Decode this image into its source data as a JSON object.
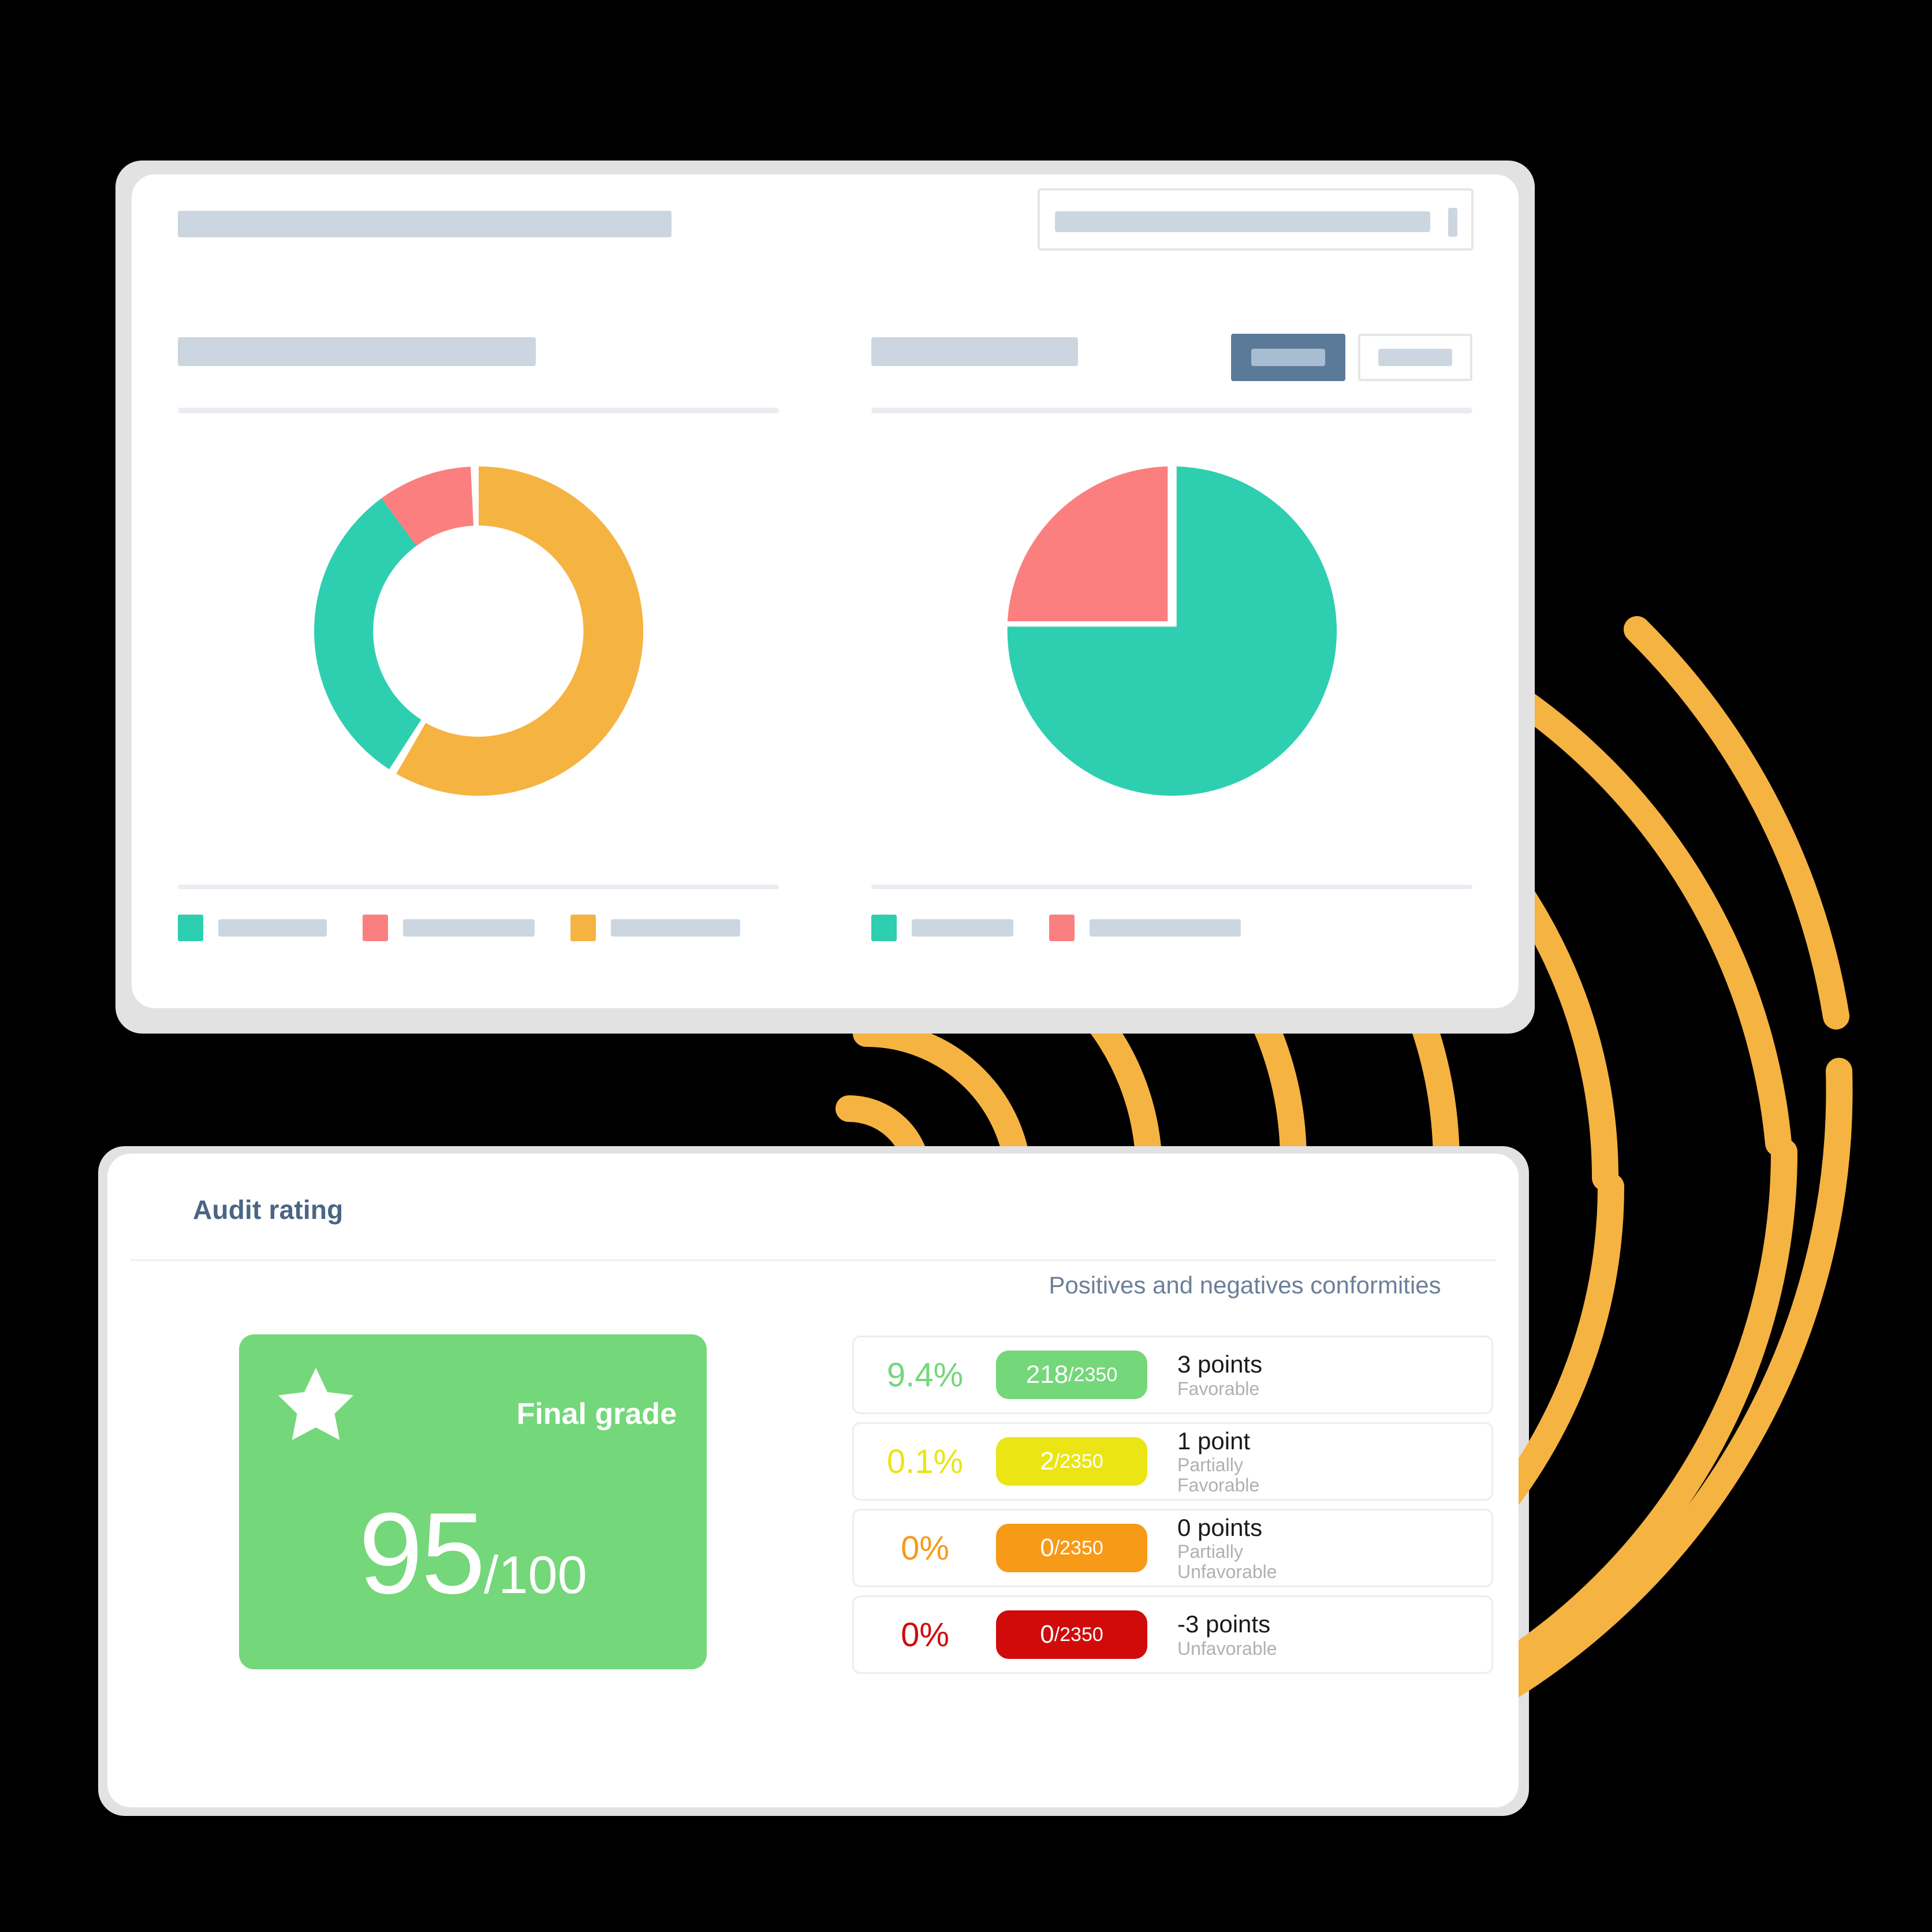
{
  "colors": {
    "teal": "#2ecfb0",
    "salmon": "#fb7f7f",
    "amber": "#f5b342",
    "fingerprint": "#f5b342",
    "slate": "#5b7a99",
    "skeleton": "#ccd6e0",
    "green": "#74d77a",
    "yellow": "#ebe515",
    "orange": "#f79a18",
    "red": "#d10a0a",
    "title_blue": "#4a6585",
    "subtitle_blue": "#6b7f99"
  },
  "dashboard_card": {
    "header": {
      "title_placeholder": "",
      "search": {
        "name": "search-input",
        "value": "",
        "placeholder": ""
      }
    },
    "panels": [
      {
        "name": "donut-panel",
        "heading_placeholder": "",
        "legend": [
          {
            "color": "#2ecfb0",
            "label": ""
          },
          {
            "color": "#fb7f7f",
            "label": ""
          },
          {
            "color": "#f5b342",
            "label": ""
          }
        ]
      },
      {
        "name": "pie-panel",
        "heading_placeholder": "",
        "toggles": [
          {
            "label": "",
            "active": true
          },
          {
            "label": "",
            "active": false
          }
        ],
        "legend": [
          {
            "color": "#2ecfb0",
            "label": ""
          },
          {
            "color": "#fb7f7f",
            "label": ""
          }
        ]
      }
    ]
  },
  "audit_card": {
    "title": "Audit rating",
    "grade": {
      "label": "Final grade",
      "icon": "star-icon",
      "value": "95",
      "total": "/100"
    },
    "conformities": {
      "title": "Positives and negatives conformities",
      "rows": [
        {
          "percent": "9.4%",
          "count": "218",
          "total": "/2350",
          "points": "3 points",
          "label": "Favorable",
          "color": "#74d77a"
        },
        {
          "percent": "0.1%",
          "count": "2",
          "total": "/2350",
          "points": "1 point",
          "label": "Partially\nFavorable",
          "color": "#ebe515"
        },
        {
          "percent": "0%",
          "count": "0",
          "total": "/2350",
          "points": "0 points",
          "label": "Partially\nUnfavorable",
          "color": "#f79a18"
        },
        {
          "percent": "0%",
          "count": "0",
          "total": "/2350",
          "points": "-3 points",
          "label": "Unfavorable",
          "color": "#d10a0a"
        }
      ]
    }
  },
  "chart_data": [
    {
      "type": "pie",
      "name": "donut-chart",
      "variant": "donut",
      "title": "",
      "categories": [
        "teal",
        "salmon",
        "amber"
      ],
      "values": [
        28,
        14,
        58
      ],
      "colors": [
        "#2ecfb0",
        "#fb7f7f",
        "#f5b342"
      ],
      "legend": "bottom",
      "inner_radius_pct": 55
    },
    {
      "type": "pie",
      "name": "pie-chart",
      "variant": "pie",
      "title": "",
      "categories": [
        "teal",
        "salmon"
      ],
      "values": [
        76,
        24
      ],
      "colors": [
        "#2ecfb0",
        "#fb7f7f"
      ],
      "legend": "bottom",
      "inner_radius_pct": 0
    }
  ]
}
